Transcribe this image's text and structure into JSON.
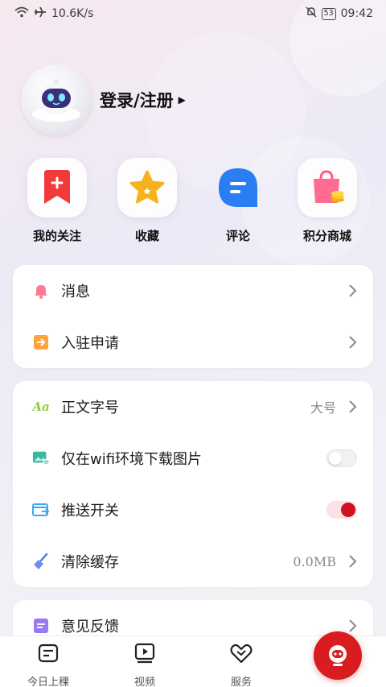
{
  "status_bar": {
    "network_speed": "10.6K/s",
    "battery": "53",
    "time": "09:42",
    "icons": [
      "wifi-icon",
      "airplane-icon",
      "mute-bell-icon",
      "battery-icon"
    ]
  },
  "profile": {
    "login_label": "登录/注册",
    "avatar_icon": "robot-avatar-icon"
  },
  "quick_actions": [
    {
      "label": "我的关注",
      "icon": "bookmark-plus-icon",
      "color": "#f23a3a"
    },
    {
      "label": "收藏",
      "icon": "star-icon",
      "color": "#f6b21a"
    },
    {
      "label": "评论",
      "icon": "comment-icon",
      "color": "#2b7df3"
    },
    {
      "label": "积分商城",
      "icon": "shopping-bag-icon",
      "color": "#ff5f86"
    }
  ],
  "card1": {
    "rows": [
      {
        "label": "消息",
        "icon": "bell-icon"
      },
      {
        "label": "入驻申请",
        "icon": "enter-icon"
      }
    ]
  },
  "card2": {
    "rows": [
      {
        "label": "正文字号",
        "value": "大号",
        "icon": "font-size-icon"
      },
      {
        "label": "仅在wifi环境下载图片",
        "icon": "image-wifi-icon",
        "toggle": false
      },
      {
        "label": "推送开关",
        "icon": "push-icon",
        "toggle": true
      },
      {
        "label": "清除缓存",
        "value": "0.0MB",
        "icon": "broom-icon"
      }
    ]
  },
  "card3": {
    "rows": [
      {
        "label": "意见反馈",
        "icon": "feedback-icon"
      }
    ]
  },
  "bottom_nav": [
    {
      "label": "今日上稞",
      "icon": "news-icon"
    },
    {
      "label": "视频",
      "icon": "video-icon"
    },
    {
      "label": "服务",
      "icon": "handshake-icon"
    }
  ],
  "fab": {
    "icon": "robot-fab-icon"
  },
  "colors": {
    "accent": "#d81c1f",
    "toggle_on": "#cf1120"
  }
}
